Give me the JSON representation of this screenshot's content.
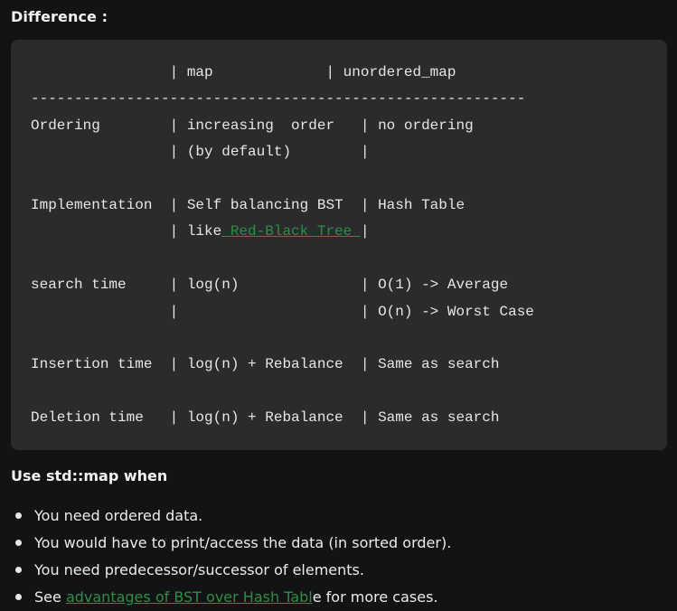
{
  "heading": "Difference :",
  "code": {
    "header_line": "                | map             | unordered_map",
    "separator": "---------------------------------------------------------",
    "ordering_1": "Ordering        | increasing  order   | no ordering",
    "ordering_2": "                | (by default)        |",
    "impl_1": "Implementation  | Self balancing BST  | Hash Table",
    "impl_2_prefix": "                | like",
    "impl_2_link": " Red-Black Tree ",
    "impl_2_suffix": "|",
    "search_1": "search time     | log(n)              | O(1) -> Average",
    "search_2": "                |                     | O(n) -> Worst Case",
    "insertion": "Insertion time  | log(n) + Rebalance  | Same as search",
    "deletion": "Deletion time   | log(n) + Rebalance  | Same as search"
  },
  "subheading": "Use std::map when",
  "bullets": {
    "b1": "You need ordered data.",
    "b2": "You would have to print/access the data (in sorted order).",
    "b3": "You need predecessor/successor of elements.",
    "b4_prefix": "See ",
    "b4_link": "advantages of BST over Hash Tabl",
    "b4_suffix": "e for more cases."
  },
  "colors": {
    "background": "#111315",
    "code_background": "#2a2b2d",
    "link": "#2f8d46"
  }
}
